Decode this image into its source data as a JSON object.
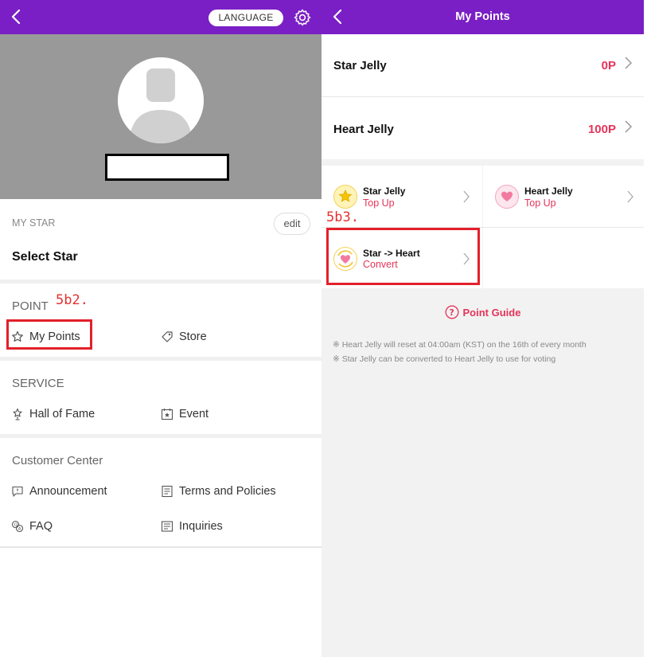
{
  "left": {
    "language_label": "LANGUAGE",
    "my_star": {
      "label": "MY STAR",
      "edit_label": "edit",
      "select_label": "Select Star"
    },
    "point": {
      "label": "POINT",
      "annotation": "5b2.",
      "items": [
        "My Points",
        "Store"
      ]
    },
    "service": {
      "label": "SERVICE",
      "items": [
        "Hall of Fame",
        "Event"
      ]
    },
    "customer_center": {
      "label": "Customer Center",
      "items": [
        "Announcement",
        "Terms and Policies",
        "FAQ",
        "Inquiries"
      ]
    }
  },
  "right": {
    "title": "My Points",
    "star_jelly": {
      "label": "Star Jelly",
      "value": "0P"
    },
    "heart_jelly": {
      "label": "Heart Jelly",
      "value": "100P"
    },
    "cards": [
      {
        "title": "Star Jelly",
        "sub": "Top Up"
      },
      {
        "title": "Heart Jelly",
        "sub": "Top Up"
      },
      {
        "title": "Star -> Heart",
        "sub": "Convert"
      }
    ],
    "annotation": "5b3.",
    "point_guide": "Point Guide",
    "notes": [
      "※ Heart Jelly will reset at 04:00am (KST) on the 16th of every month",
      "※ Star Jelly can be converted to Heart Jelly to use for voting"
    ],
    "colors": {
      "accent": "#e5345a",
      "header": "#7a1fc5"
    }
  }
}
